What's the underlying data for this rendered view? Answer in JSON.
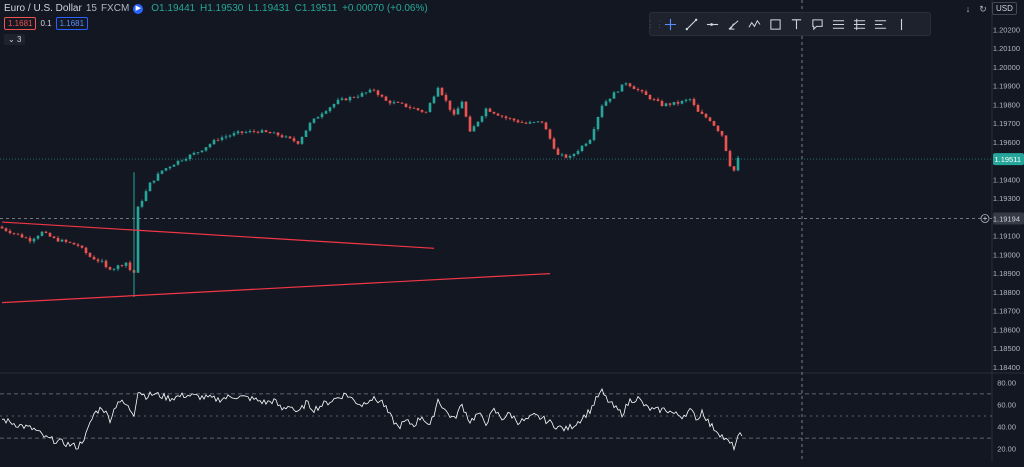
{
  "header": {
    "symbol": "Euro / U.S. Dollar",
    "interval": "15",
    "exchange": "FXCM",
    "open": "O1.19441",
    "high": "H1.19530",
    "low": "L1.19431",
    "close": "C1.19511",
    "change": "+0.00070 (+0.06%)",
    "live_icon": "replay-icon"
  },
  "trade": {
    "sell_price": "1.1681",
    "buy_price": "1.1681",
    "spread": "0.1",
    "collapse_count": "3"
  },
  "top_right": {
    "currency": "USD",
    "arrow_icon": "download-arrow-icon",
    "refresh_icon": "refresh-icon"
  },
  "toolbar": {
    "tools": [
      "drag-handle-icon",
      "crosshair-icon",
      "trend-line-icon",
      "horizontal-ray-icon",
      "pitchfork-icon",
      "path-icon",
      "rectangle-icon",
      "text-icon",
      "callout-icon",
      "long-position-icon",
      "short-position-icon",
      "price-range-icon",
      "vertical-line-icon"
    ]
  },
  "colors": {
    "background": "#131722",
    "up": "#26a69a",
    "down": "#ef5350",
    "trendline": "#f23645",
    "oscillator": "#ffffff",
    "grid_dash": "#9598a1",
    "last_price_bg": "#26a69a",
    "crosshair_label_bg": "#363a45"
  },
  "chart_data": [
    {
      "type": "candlestick",
      "title": "",
      "price_axis_ticks": [
        "1.20200",
        "1.20100",
        "1.20000",
        "1.19900",
        "1.19800",
        "1.19700",
        "1.19600",
        "1.19500",
        "1.19400",
        "1.19300",
        "1.19200",
        "1.19100",
        "1.19000",
        "1.18900",
        "1.18800",
        "1.18700",
        "1.18600",
        "1.18500",
        "1.18400"
      ],
      "ylim": [
        1.18375,
        1.20285
      ],
      "last_price": 1.19511,
      "last_price_label": "1.19511",
      "crosshair_price": 1.19194,
      "crosshair_label": "1.19194",
      "crosshair_index": 200,
      "grid": false,
      "trendlines": [
        {
          "x": [
            0,
            108
          ],
          "y": [
            1.19175,
            1.19035
          ]
        },
        {
          "x": [
            0,
            137
          ],
          "y": [
            1.18745,
            1.189
          ]
        }
      ],
      "close_path": [
        [
          0,
          1.1915
        ],
        [
          8,
          1.1908
        ],
        [
          11,
          1.1912
        ],
        [
          14,
          1.19085
        ],
        [
          20,
          1.1905
        ],
        [
          23,
          1.1899
        ],
        [
          26,
          1.1896
        ],
        [
          29,
          1.1893
        ],
        [
          32,
          1.1896
        ],
        [
          34,
          1.18905
        ],
        [
          26.5,
          1.1893
        ],
        [
          30,
          1.1894
        ],
        [
          33,
          1.1892
        ],
        [
          34.5,
          1.1895
        ],
        [
          33.3,
          1.1898
        ],
        [
          35,
          1.1925
        ],
        [
          38,
          1.1938
        ],
        [
          41,
          1.1945
        ],
        [
          45,
          1.195
        ],
        [
          50,
          1.1955
        ],
        [
          55,
          1.1962
        ],
        [
          60,
          1.1965
        ],
        [
          65,
          1.1966
        ],
        [
          70,
          1.1964
        ],
        [
          75,
          1.196
        ],
        [
          78,
          1.197
        ],
        [
          81,
          1.1976
        ],
        [
          85,
          1.1982
        ],
        [
          90,
          1.1985
        ],
        [
          94,
          1.1988
        ],
        [
          97,
          1.1982
        ],
        [
          101,
          1.198
        ],
        [
          104,
          1.1978
        ],
        [
          107,
          1.1976
        ],
        [
          110,
          1.199
        ],
        [
          114,
          1.1974
        ],
        [
          116,
          1.1982
        ],
        [
          118,
          1.1965
        ],
        [
          122,
          1.1978
        ],
        [
          127,
          1.1973
        ],
        [
          132,
          1.197
        ],
        [
          136,
          1.1971
        ],
        [
          140,
          1.1953
        ],
        [
          143,
          1.1952
        ],
        [
          148,
          1.1962
        ],
        [
          151,
          1.198
        ],
        [
          154,
          1.1986
        ],
        [
          157,
          1.1992
        ],
        [
          162,
          1.1985
        ],
        [
          166,
          1.198
        ],
        [
          170,
          1.1981
        ],
        [
          173,
          1.1983
        ],
        [
          175,
          1.1976
        ],
        [
          178,
          1.1972
        ],
        [
          181,
          1.1964
        ],
        [
          183,
          1.1948
        ],
        [
          184,
          1.1945
        ],
        [
          184.5,
          1.19511
        ]
      ],
      "candle_count": 185
    },
    {
      "type": "line",
      "title": "",
      "series": [
        {
          "name": "",
          "values_summary": "oscillator"
        }
      ],
      "ylim": [
        12,
        88
      ],
      "axis_ticks": [
        "80.00",
        "60.00",
        "40.00",
        "20.00"
      ],
      "upper_band": 70,
      "lower_band": 30,
      "mid_band": 50,
      "points": [
        [
          0,
          47
        ],
        [
          4,
          42
        ],
        [
          8,
          38
        ],
        [
          11,
          30
        ],
        [
          14,
          27
        ],
        [
          17,
          24
        ],
        [
          19,
          22
        ],
        [
          21,
          33
        ],
        [
          23,
          52
        ],
        [
          25,
          58
        ],
        [
          27,
          47
        ],
        [
          29,
          64
        ],
        [
          31,
          60
        ],
        [
          33,
          52
        ],
        [
          34,
          73
        ],
        [
          36,
          68
        ],
        [
          38,
          70
        ],
        [
          42,
          66
        ],
        [
          46,
          69
        ],
        [
          50,
          67
        ],
        [
          54,
          65
        ],
        [
          58,
          68
        ],
        [
          62,
          66
        ],
        [
          66,
          62
        ],
        [
          68,
          64
        ],
        [
          70,
          56
        ],
        [
          72,
          60
        ],
        [
          74,
          52
        ],
        [
          76,
          62
        ],
        [
          78,
          56
        ],
        [
          80,
          60
        ],
        [
          83,
          65
        ],
        [
          86,
          70
        ],
        [
          88,
          64
        ],
        [
          90,
          60
        ],
        [
          92,
          66
        ],
        [
          95,
          63
        ],
        [
          97,
          50
        ],
        [
          99,
          40
        ],
        [
          101,
          45
        ],
        [
          103,
          42
        ],
        [
          105,
          50
        ],
        [
          107,
          40
        ],
        [
          109,
          65
        ],
        [
          111,
          54
        ],
        [
          113,
          47
        ],
        [
          115,
          60
        ],
        [
          117,
          45
        ],
        [
          119,
          52
        ],
        [
          121,
          44
        ],
        [
          123,
          55
        ],
        [
          125,
          48
        ],
        [
          127,
          52
        ],
        [
          129,
          45
        ],
        [
          131,
          46
        ],
        [
          133,
          50
        ],
        [
          135,
          48
        ],
        [
          137,
          44
        ],
        [
          139,
          40
        ],
        [
          141,
          38
        ],
        [
          143,
          42
        ],
        [
          145,
          48
        ],
        [
          147,
          55
        ],
        [
          149,
          68
        ],
        [
          150,
          72
        ],
        [
          151,
          66
        ],
        [
          153,
          58
        ],
        [
          155,
          52
        ],
        [
          157,
          64
        ],
        [
          159,
          66
        ],
        [
          161,
          58
        ],
        [
          163,
          55
        ],
        [
          166,
          56
        ],
        [
          168,
          52
        ],
        [
          170,
          50
        ],
        [
          172,
          55
        ],
        [
          174,
          47
        ],
        [
          175,
          55
        ],
        [
          177,
          42
        ],
        [
          179,
          36
        ],
        [
          181,
          28
        ],
        [
          183,
          22
        ],
        [
          184,
          30
        ],
        [
          184.5,
          32
        ]
      ]
    }
  ]
}
